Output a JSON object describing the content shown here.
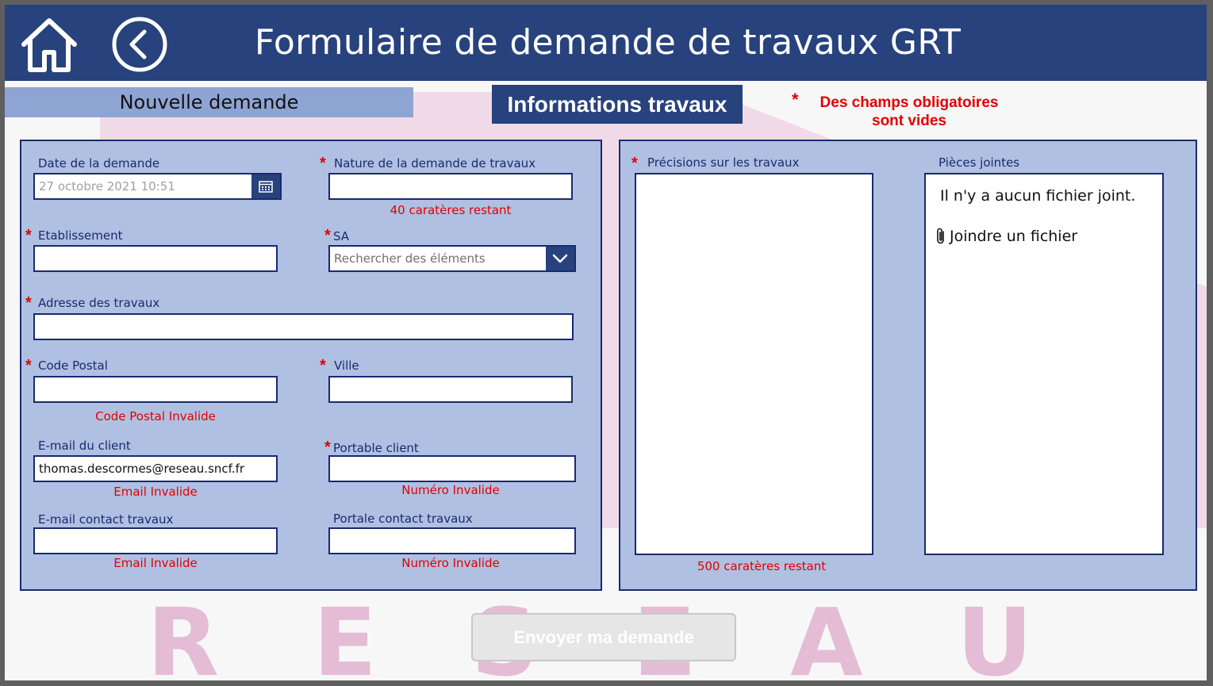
{
  "header": {
    "title": "Formulaire de demande de travaux GRT",
    "home_icon": "home-icon",
    "back_icon": "chevron-left-circle-icon"
  },
  "tabs": {
    "nouvelle_demande": "Nouvelle demande",
    "informations_travaux": "Informations travaux"
  },
  "warning": {
    "star": "*",
    "line1": "Des champs obligatoires",
    "line2": "sont vides"
  },
  "form": {
    "required_mark": "*",
    "date": {
      "label": "Date de la demande",
      "value": "27 octobre 2021 10:51",
      "icon": "calendar-icon"
    },
    "nature": {
      "label": "Nature de la demande de travaux",
      "value": "",
      "counter": "40 caratères restant"
    },
    "etablissement": {
      "label": "Etablissement",
      "value": ""
    },
    "sa": {
      "label": "SA",
      "placeholder": "Rechercher des éléments",
      "icon": "chevron-down-icon"
    },
    "adresse": {
      "label": "Adresse des travaux",
      "value": ""
    },
    "code_postal": {
      "label": "Code Postal",
      "value": "",
      "error": "Code Postal Invalide"
    },
    "ville": {
      "label": "Ville",
      "value": ""
    },
    "email_client": {
      "label": "E-mail du client",
      "value": "thomas.descormes@reseau.sncf.fr",
      "error": "Email Invalide"
    },
    "portable_client": {
      "label": "Portable client",
      "value": "",
      "error": "Numéro Invalide"
    },
    "email_contact": {
      "label": "E-mail contact travaux",
      "value": "",
      "error": "Email Invalide"
    },
    "portable_contact": {
      "label": "Portale contact travaux",
      "value": "",
      "error": "Numéro Invalide"
    }
  },
  "details": {
    "precisions": {
      "label": "Précisions sur les travaux",
      "value": "",
      "counter": "500 caratères restant"
    },
    "pieces_jointes": {
      "label": "Pièces jointes",
      "empty_text": "Il n'y a aucun fichier joint.",
      "attach_label": "Joindre un fichier",
      "attach_icon": "paperclip-icon"
    }
  },
  "submit": {
    "label": "Envoyer ma demande"
  },
  "watermark": [
    "R",
    "E",
    "S",
    "E",
    "A",
    "U"
  ],
  "colors": {
    "header_bg": "#27427d",
    "panel_bg": "#b0c0e2",
    "error": "#e20000"
  }
}
